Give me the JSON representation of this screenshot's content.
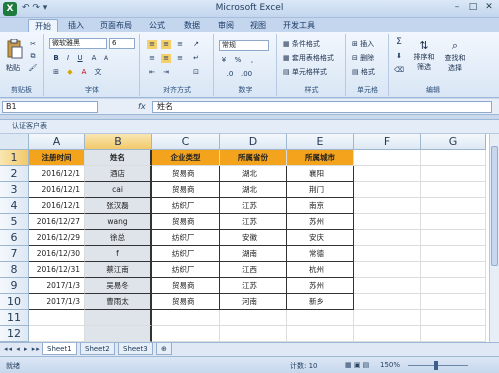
{
  "window": {
    "title": "Microsoft Excel",
    "quick_access": "↶ ↷ ▾"
  },
  "tabs": [
    "开始",
    "插入",
    "页面布局",
    "公式",
    "数据",
    "审阅",
    "视图",
    "开发工具"
  ],
  "ribbon": {
    "clipboard": {
      "paste": "粘贴",
      "label": "剪贴板"
    },
    "font": {
      "name": "微软雅黑",
      "size": "6",
      "label": "字体",
      "bold": "B",
      "italic": "I",
      "underline": "U"
    },
    "alignment": {
      "label": "对齐方式"
    },
    "number": {
      "format": "常规",
      "label": "数字",
      "percent": "%",
      "comma": ","
    },
    "styles": {
      "conditional": "条件格式",
      "table": "套用表格格式",
      "cell": "单元格样式",
      "label": "样式"
    },
    "cells": {
      "insert": "插入",
      "delete": "删除",
      "format": "格式",
      "label": "单元格"
    },
    "editing": {
      "sigma": "Σ",
      "sort": "排序和",
      "filter": "筛选",
      "find": "查找和",
      "select": "选择",
      "label": "编辑"
    }
  },
  "formula_bar": {
    "name_box": "B1",
    "fx": "fx",
    "value": "姓名"
  },
  "document": {
    "title": "认证客户表"
  },
  "grid": {
    "columns": [
      "A",
      "B",
      "C",
      "D",
      "E",
      "F",
      "G"
    ],
    "rows": [
      "1",
      "2",
      "3",
      "4",
      "5",
      "6",
      "7",
      "8",
      "9",
      "10",
      "11",
      "12",
      "13"
    ],
    "selected_column": "B",
    "selected_row": "1",
    "header": [
      "注册时间",
      "姓名",
      "企业类型",
      "所属省份",
      "所属城市"
    ],
    "data": [
      [
        "2016/12/1",
        "酒店",
        "贸易商",
        "湖北",
        "襄阳"
      ],
      [
        "2016/12/1",
        "cai",
        "贸易商",
        "湖北",
        "荆门"
      ],
      [
        "2016/12/1",
        "张汉磊",
        "纺织厂",
        "江苏",
        "南京"
      ],
      [
        "2016/12/27",
        "wang",
        "贸易商",
        "江苏",
        "苏州"
      ],
      [
        "2016/12/29",
        "徐总",
        "纺织厂",
        "安徽",
        "安庆"
      ],
      [
        "2016/12/30",
        "f",
        "纺织厂",
        "湖南",
        "常德"
      ],
      [
        "2016/12/31",
        "蔡江南",
        "纺织厂",
        "江西",
        "杭州"
      ],
      [
        "2017/1/3",
        "吴易冬",
        "贸易商",
        "江苏",
        "苏州"
      ],
      [
        "2017/1/3",
        "曹雨太",
        "贸易商",
        "河南",
        "新乡"
      ]
    ]
  },
  "sheets": [
    "Sheet1",
    "Sheet2",
    "Sheet3"
  ],
  "status": {
    "ready": "就绪",
    "count": "计数: 10",
    "zoom": "150%"
  },
  "colors": {
    "header_fill": "#f3a31c",
    "selection": "#f2c96a",
    "ribbon": "#d9e6f5"
  }
}
